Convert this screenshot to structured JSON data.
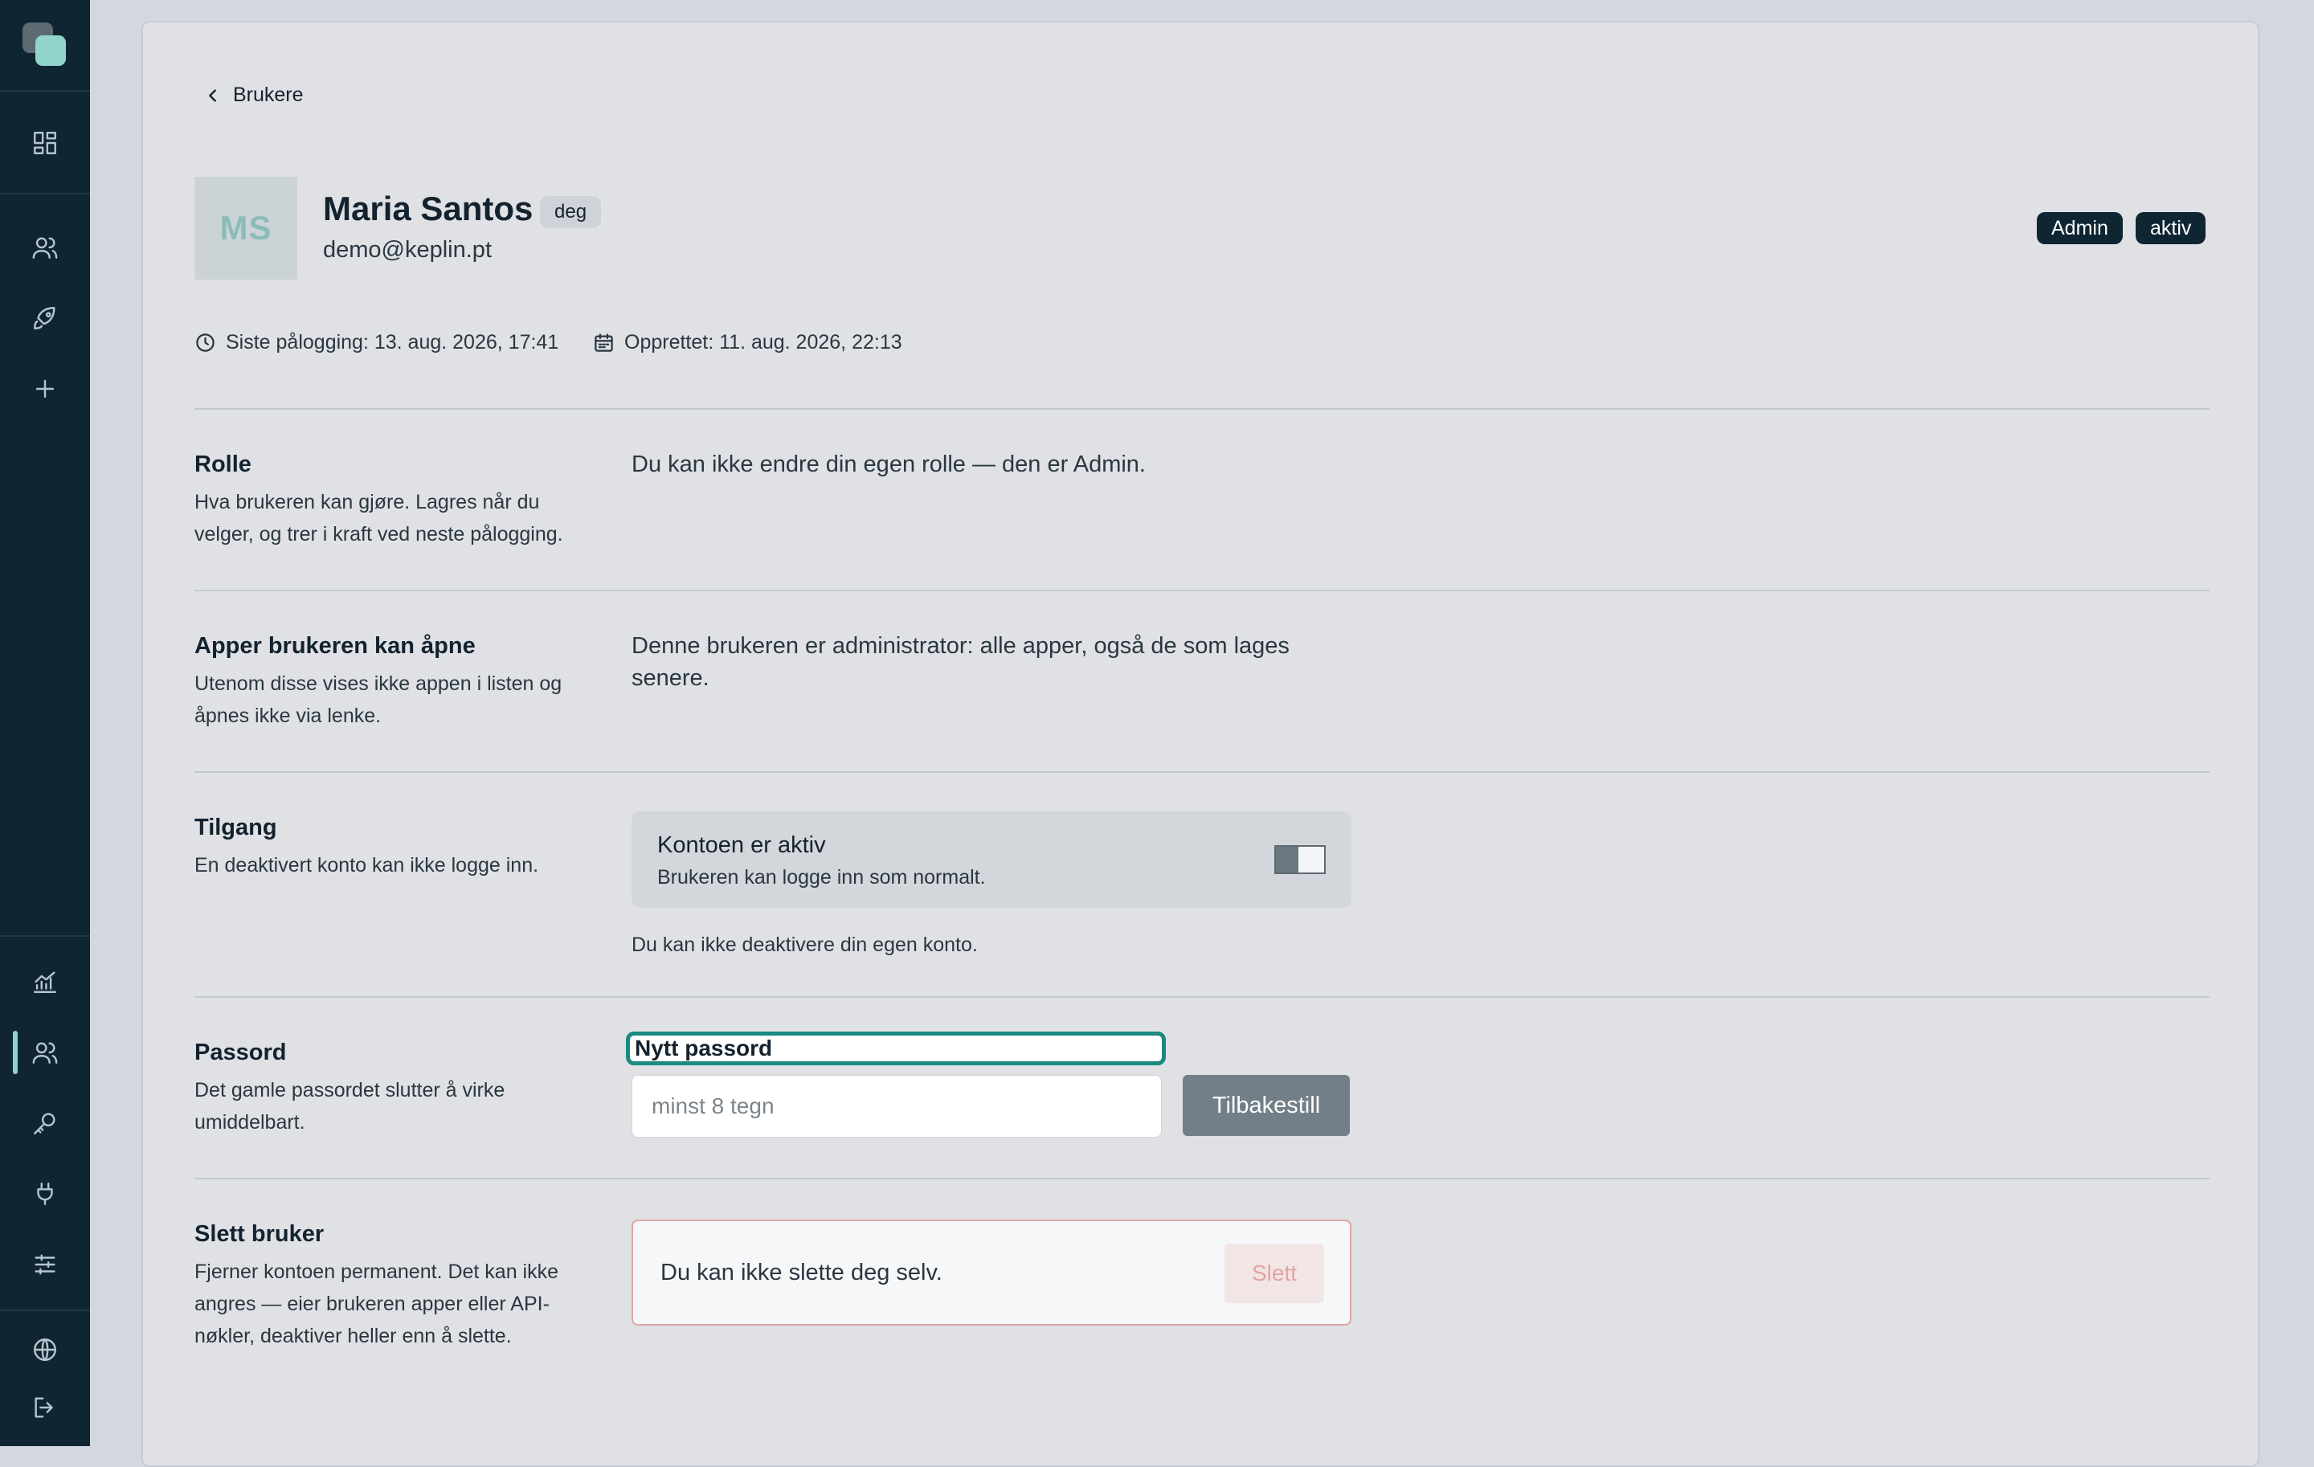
{
  "sidebar": {
    "icons": [
      "dashboard-icon",
      "users-icon",
      "rocket-icon",
      "plus-icon",
      "chart-icon",
      "users-icon",
      "key-icon",
      "plug-icon",
      "sliders-icon",
      "globe-icon",
      "logout-icon"
    ]
  },
  "header": {
    "back_label": "Brukere",
    "initials": "MS",
    "name": "Maria Santos",
    "you_badge": "deg",
    "email": "demo@keplin.pt",
    "role_pill": "Admin",
    "status_pill": "aktiv",
    "last_login": "Siste pålogging: 13. aug. 2026, 17:41",
    "created": "Opprettet: 11. aug. 2026, 22:13"
  },
  "sections": {
    "role": {
      "title": "Rolle",
      "desc": "Hva brukeren kan gjøre. Lagres når du velger, og trer i kraft ved neste pålogging.",
      "body": "Du kan ikke endre din egen rolle — den er Admin."
    },
    "apps": {
      "title": "Apper brukeren kan åpne",
      "desc": "Utenom disse vises ikke appen i listen og åpnes ikke via lenke.",
      "body": "Denne brukeren er administrator: alle apper, også de som lages senere."
    },
    "access": {
      "title": "Tilgang",
      "desc": "En deaktivert konto kan ikke logge inn.",
      "toggle_title": "Kontoen er aktiv",
      "toggle_sub": "Brukeren kan logge inn som normalt.",
      "note": "Du kan ikke deaktivere din egen konto."
    },
    "password": {
      "title": "Passord",
      "desc": "Det gamle passordet slutter å virke umiddelbart.",
      "field_label": "Nytt passord",
      "placeholder": "minst 8 tegn",
      "value": "",
      "button": "Tilbakestill"
    },
    "delete": {
      "title": "Slett bruker",
      "desc": "Fjerner kontoen permanent. Det kan ikke angres — eier brukeren apper eller API-nøkler, deaktiver heller enn å slette.",
      "message": "Du kan ikke slette deg selv.",
      "button": "Slett"
    }
  },
  "colors": {
    "sidebar": "#0f2632",
    "accent": "#1a8a82",
    "danger_border": "#e3a3a3"
  }
}
